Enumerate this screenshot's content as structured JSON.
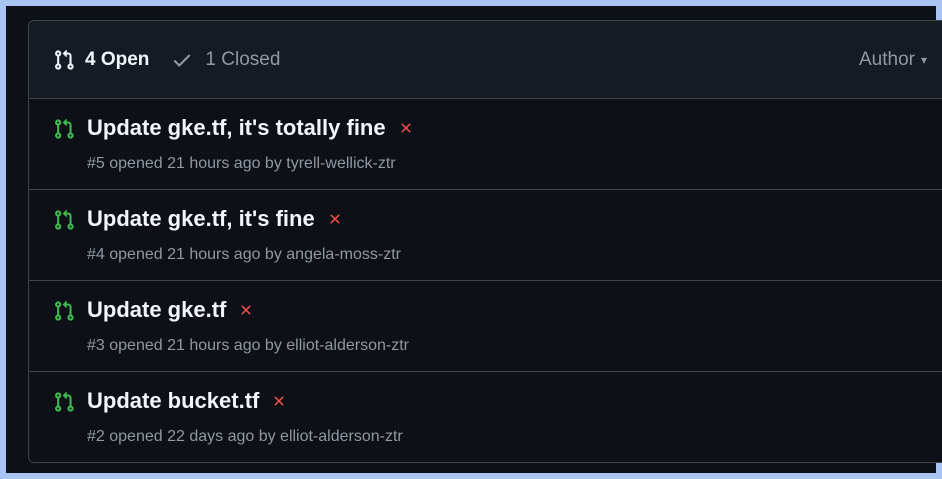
{
  "header": {
    "open_count_label": "4 Open",
    "closed_count_label": "1 Closed",
    "author_filter_label": "Author"
  },
  "colors": {
    "open_icon": "#3fb950",
    "failed_status": "#f85149",
    "background": "#0d1117",
    "header_background": "#151b23",
    "border": "#3d444d",
    "text_primary": "#f0f6fc",
    "text_muted": "#9198a1"
  },
  "pull_requests": [
    {
      "title": "Update gke.tf, it's totally fine",
      "meta": "#5 opened 21 hours ago by tyrell-wellick-ztr",
      "status_icon": "x-icon"
    },
    {
      "title": "Update gke.tf, it's fine",
      "meta": "#4 opened 21 hours ago by angela-moss-ztr",
      "status_icon": "x-icon"
    },
    {
      "title": "Update gke.tf",
      "meta": "#3 opened 21 hours ago by elliot-alderson-ztr",
      "status_icon": "x-icon"
    },
    {
      "title": "Update bucket.tf",
      "meta": "#2 opened 22 days ago by elliot-alderson-ztr",
      "status_icon": "x-icon"
    }
  ]
}
